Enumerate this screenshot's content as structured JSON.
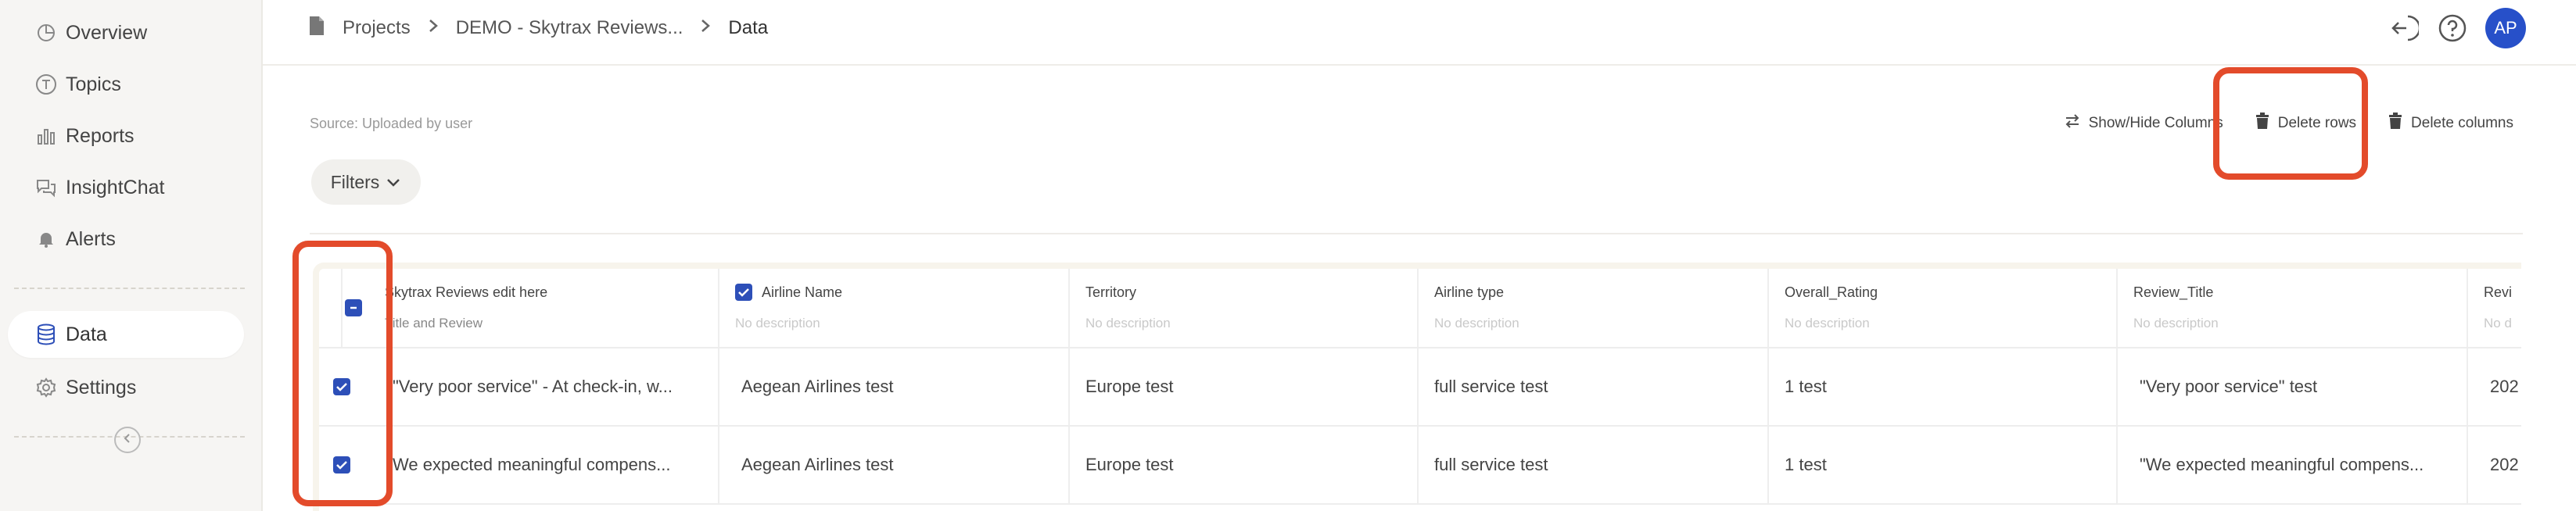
{
  "sidebar": {
    "items": [
      {
        "label": "Overview",
        "icon": "chart-pie-icon"
      },
      {
        "label": "Topics",
        "icon": "topic-t-icon"
      },
      {
        "label": "Reports",
        "icon": "bar-chart-icon"
      },
      {
        "label": "InsightChat",
        "icon": "chat-bubbles-icon"
      },
      {
        "label": "Alerts",
        "icon": "bell-icon"
      },
      {
        "label": "Data",
        "icon": "database-icon"
      },
      {
        "label": "Settings",
        "icon": "gear-icon"
      }
    ]
  },
  "breadcrumb": {
    "items": [
      "Projects",
      "DEMO - Skytrax Reviews...",
      "Data"
    ]
  },
  "user": {
    "initials": "AP"
  },
  "page": {
    "source": "Source: Uploaded by user"
  },
  "toolbar": {
    "show_hide": "Show/Hide Columns",
    "delete_rows": "Delete rows",
    "delete_columns": "Delete columns"
  },
  "filters": {
    "label": "Filters"
  },
  "table": {
    "columns": [
      {
        "title": "Skytrax Reviews edit here",
        "desc": "Title and Review"
      },
      {
        "title": "Airline Name",
        "desc": "No description"
      },
      {
        "title": "Territory",
        "desc": "No description"
      },
      {
        "title": "Airline type",
        "desc": "No description"
      },
      {
        "title": "Overall_Rating",
        "desc": "No description"
      },
      {
        "title": "Review_Title",
        "desc": "No description"
      },
      {
        "title": "Revi",
        "desc": "No d"
      }
    ],
    "rows": [
      [
        "\"Very poor service\" - At check-in, w...",
        "Aegean Airlines test",
        "Europe test",
        "full service test",
        "1 test",
        "\"Very poor service\" test",
        "202"
      ],
      [
        "We expected meaningful compens...",
        "Aegean Airlines test",
        "Europe test",
        "full service test",
        "1 test",
        "\"We expected meaningful compens...",
        "202"
      ]
    ]
  },
  "colors": {
    "accent": "#2d4fb8",
    "avatar": "#2750c9",
    "highlight": "#e34b2b"
  }
}
